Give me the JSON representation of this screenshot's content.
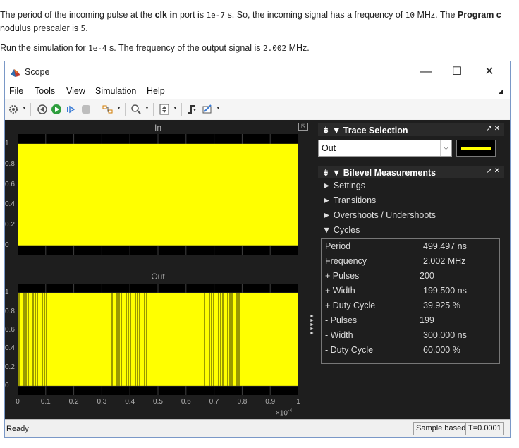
{
  "doc": {
    "p1_a": "The period of the incoming pulse at the ",
    "p1_b": "clk in",
    "p1_c": " port is ",
    "p1_d": "1e-7",
    "p1_e": " s. So, the incoming signal has a frequency of ",
    "p1_f": "10",
    "p1_g": " MHz. The ",
    "p1_h": "Program c",
    "p2": "nodulus prescaler is ",
    "p2_code": "5",
    "p2_end": ".",
    "p3_a": "Run the simulation for ",
    "p3_b": "1e-4",
    "p3_c": " s. The frequency of the output signal is ",
    "p3_d": "2.002",
    "p3_e": " MHz."
  },
  "window": {
    "title": "Scope",
    "minimize": "—",
    "maximize": "☐",
    "close": "✕"
  },
  "menu": {
    "file": "File",
    "tools": "Tools",
    "view": "View",
    "simulation": "Simulation",
    "help": "Help"
  },
  "toolbar": {
    "icons": [
      "gear-icon",
      "step-back-icon",
      "run-icon",
      "step-forward-icon",
      "stop-icon",
      "highlight-icon",
      "zoom-icon",
      "autoscale-icon",
      "triggers-icon",
      "measurements-icon"
    ]
  },
  "plots": {
    "in_title": "In",
    "out_title": "Out",
    "yticks": [
      "1",
      "0.8",
      "0.6",
      "0.4",
      "0.2",
      "0"
    ],
    "xticks": [
      "0",
      "0.1",
      "0.2",
      "0.3",
      "0.4",
      "0.5",
      "0.6",
      "0.7",
      "0.8",
      "0.9",
      "1"
    ],
    "x_exponent": "×10",
    "x_exponent_power": "-4",
    "trace_color": "#ffff00"
  },
  "chart_data": [
    {
      "type": "line",
      "title": "In",
      "xlim": [
        0,
        0.0001
      ],
      "ylim": [
        -0.1,
        1.1
      ],
      "description_values": "square pulse train toggling 0/1, period 1e-7 s (rendered as solid fill)",
      "series": [
        {
          "name": "In",
          "color": "#ffff00"
        }
      ]
    },
    {
      "type": "line",
      "title": "Out",
      "xlim": [
        0,
        0.0001
      ],
      "ylim": [
        -0.1,
        1.1
      ],
      "series": [
        {
          "name": "Out",
          "color": "#ffff00"
        }
      ]
    }
  ],
  "trace_selection": {
    "title": "Trace Selection",
    "selected": "Out",
    "controls": "↗ ✕"
  },
  "bilevel": {
    "title": "Bilevel Measurements",
    "controls": "↗ ✕",
    "settings": "► Settings",
    "transitions": "► Transitions",
    "overshoots": "► Overshoots / Undershoots",
    "cycles": "▼ Cycles",
    "rows": [
      {
        "label": "Period",
        "value": "499.497 ns"
      },
      {
        "label": "Frequency",
        "value": "2.002 MHz"
      },
      {
        "label": "+ Pulses",
        "value": "200"
      },
      {
        "label": "+ Width",
        "value": "199.500 ns"
      },
      {
        "label": "+ Duty Cycle",
        "value": "39.925 %"
      },
      {
        "label": "- Pulses",
        "value": "199"
      },
      {
        "label": "- Width",
        "value": "300.000 ns"
      },
      {
        "label": "- Duty Cycle",
        "value": "60.000 %"
      }
    ]
  },
  "status": {
    "left": "Ready",
    "mode": "Sample based",
    "time": "T=0.0001"
  }
}
